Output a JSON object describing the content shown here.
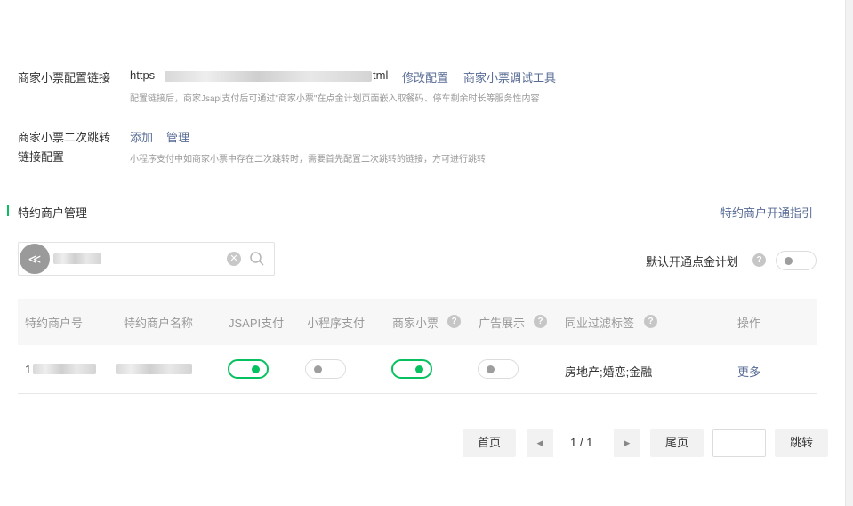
{
  "config": {
    "receipt_link_label": "商家小票配置链接",
    "url_prefix": "https",
    "url_suffix": "tml",
    "modify_link": "修改配置",
    "debug_link": "商家小票调试工具",
    "receipt_hint": "配置链接后，商家Jsapi支付后可通过\"商家小票\"在点金计划页面嵌入取餐码、停车剩余时长等服务性内容",
    "redirect_label_line1": "商家小票二次跳转",
    "redirect_label_line2": "链接配置",
    "add_link": "添加",
    "manage_link": "管理",
    "redirect_hint": "小程序支付中如商家小票中存在二次跳转时，需要首先配置二次跳转的链接，方可进行跳转"
  },
  "section": {
    "title": "特约商户管理",
    "guide_link": "特约商户开通指引"
  },
  "search": {
    "avatar_glyph": "≪",
    "placeholder": ""
  },
  "default_toggle": {
    "label": "默认开通点金计划",
    "help": "?",
    "on": false
  },
  "table": {
    "headers": [
      "特约商户号",
      "特约商户名称",
      "JSAPI支付",
      "小程序支付",
      "商家小票",
      "广告展示",
      "同业过滤标签",
      "操作"
    ],
    "help_glyph": "?",
    "rows": [
      {
        "merchant_id_visible": "1",
        "jsapi": true,
        "miniprogram": false,
        "receipt": true,
        "ads": false,
        "tags": "房地产;婚恋;金融",
        "action": "更多"
      }
    ]
  },
  "pagination": {
    "first": "首页",
    "prev": "◀",
    "page_info": "1 / 1",
    "next": "▶",
    "last": "尾页",
    "jump": "跳转"
  },
  "colors": {
    "accent_green": "#07c160",
    "link_blue": "#576b95"
  }
}
